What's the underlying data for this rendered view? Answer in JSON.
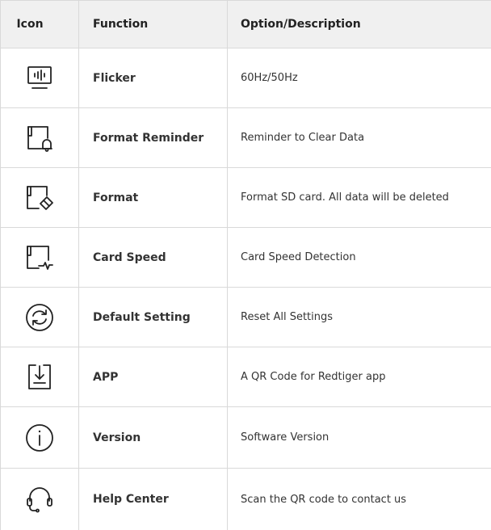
{
  "table": {
    "headers": [
      "Icon",
      "Function",
      "Option/Description"
    ],
    "rows": [
      {
        "icon": "monitor-flicker-icon",
        "function": "Flicker",
        "description": "60Hz/50Hz"
      },
      {
        "icon": "sd-card-bell-icon",
        "function": "Format Reminder",
        "description": "Reminder to Clear Data"
      },
      {
        "icon": "sd-card-eraser-icon",
        "function": "Format",
        "description": "Format SD card. All data will be deleted"
      },
      {
        "icon": "sd-card-pulse-icon",
        "function": "Card Speed",
        "description": "Card Speed Detection"
      },
      {
        "icon": "reset-circle-icon",
        "function": "Default Setting",
        "description": "Reset All Settings"
      },
      {
        "icon": "download-app-icon",
        "function": "APP",
        "description": "A QR Code for Redtiger app"
      },
      {
        "icon": "info-circle-icon",
        "function": "Version",
        "description": "Software Version"
      },
      {
        "icon": "headset-icon",
        "function": "Help Center",
        "description": "Scan the QR code to contact us"
      }
    ]
  },
  "colors": {
    "header_bg": "#f0f0f0",
    "border": "#d9d9d9",
    "text": "#333333"
  }
}
